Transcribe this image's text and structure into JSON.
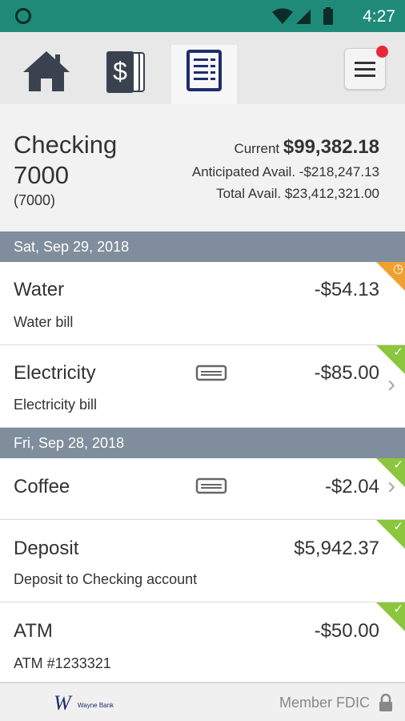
{
  "status_bar": {
    "time": "4:27"
  },
  "nav": {
    "tabs": [
      {
        "name": "home",
        "icon": "home-icon"
      },
      {
        "name": "accounts",
        "icon": "dollar-cards-icon"
      },
      {
        "name": "transactions",
        "icon": "list-document-icon",
        "active": true
      }
    ],
    "menu_icon": "hamburger-menu-icon"
  },
  "account": {
    "name": "Checking 7000",
    "number": "(7000)",
    "current_label": "Current",
    "current_value": "$99,382.18",
    "anticipated_label": "Anticipated Avail.",
    "anticipated_value": "-$218,247.13",
    "total_label": "Total Avail.",
    "total_value": "$23,412,321.00"
  },
  "groups": [
    {
      "date": "Sat, Sep 29, 2018",
      "transactions": [
        {
          "name": "Water",
          "desc": "Water bill",
          "amount": "-$54.13",
          "status": "pending"
        },
        {
          "name": "Electricity",
          "desc": "Electricity bill",
          "amount": "-$85.00",
          "status": "cleared"
        }
      ]
    },
    {
      "date": "Fri, Sep 28, 2018",
      "transactions": [
        {
          "name": "Coffee",
          "desc": "",
          "amount": "-$2.04",
          "status": "cleared"
        },
        {
          "name": "Deposit",
          "desc": "Deposit to Checking account",
          "amount": "$5,942.37",
          "status": "cleared"
        },
        {
          "name": "ATM",
          "desc": "ATM #1233321",
          "amount": "-$50.00",
          "status": "cleared"
        }
      ]
    }
  ],
  "footer": {
    "logo_text": "Wayne Bank",
    "fdic": "Member FDIC"
  },
  "colors": {
    "status_bar": "#1f8a78",
    "date_header": "#808d9c",
    "cleared": "#8cc63e",
    "pending": "#f0a030",
    "notification": "#e8273b"
  }
}
